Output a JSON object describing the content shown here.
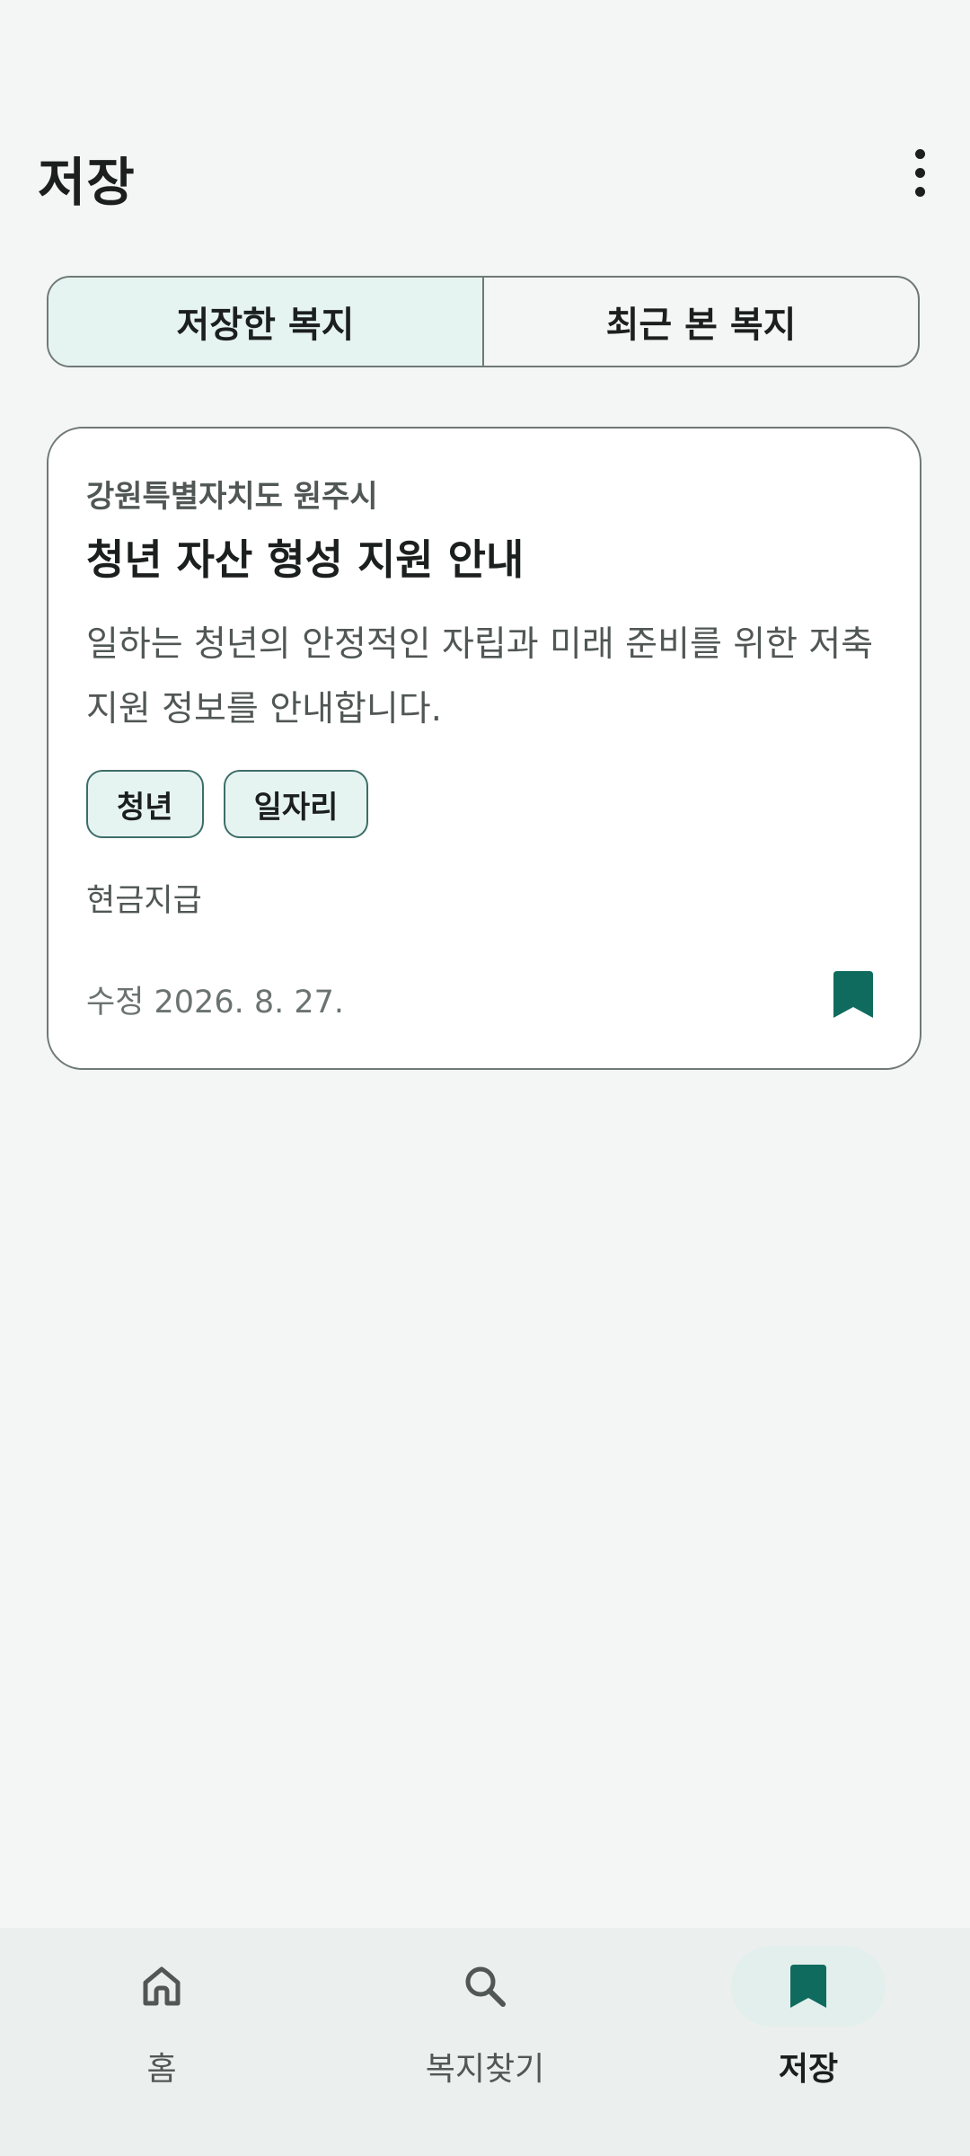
{
  "header": {
    "title": "저장"
  },
  "tabs": [
    {
      "label": "저장한 복지",
      "selected": true
    },
    {
      "label": "최근 본 복지",
      "selected": false
    }
  ],
  "card": {
    "region": "강원특별자치도 원주시",
    "title": "청년 자산 형성 지원 안내",
    "description": "일하는 청년의 안정적인 자립과 미래 준비를 위한 저축 지원 정보를 안내합니다.",
    "tags": [
      "청년",
      "일자리"
    ],
    "support_type": "현금지급",
    "updated": "수정 2026. 8. 27.",
    "bookmarked": true
  },
  "bottom_nav": [
    {
      "label": "홈",
      "icon": "home-icon",
      "active": false
    },
    {
      "label": "복지찾기",
      "icon": "search-icon",
      "active": false
    },
    {
      "label": "저장",
      "icon": "bookmark-icon",
      "active": true
    }
  ],
  "colors": {
    "accent": "#0f6b5e",
    "icon_inactive": "#505755",
    "selected_tab_bg": "#e6f4f1",
    "background": "#f4f6f5"
  }
}
